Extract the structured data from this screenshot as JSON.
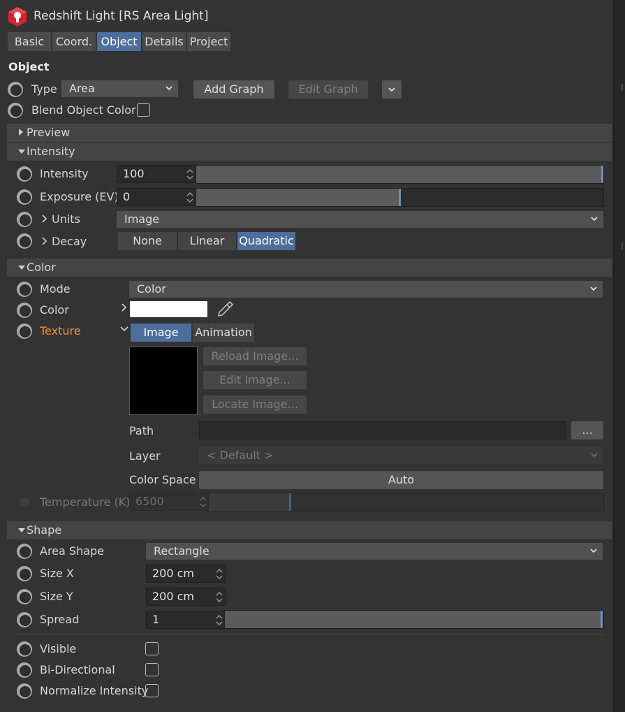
{
  "window": {
    "title": "Redshift Light [RS Area Light]"
  },
  "tabs": [
    {
      "label": "Basic"
    },
    {
      "label": "Coord."
    },
    {
      "label": "Object"
    },
    {
      "label": "Details"
    },
    {
      "label": "Project"
    }
  ],
  "object": {
    "heading": "Object",
    "type_label": "Type",
    "type_value": "Area",
    "add_graph": "Add Graph",
    "edit_graph": "Edit Graph",
    "blend_label": "Blend Object Color"
  },
  "sections": {
    "preview": "Preview",
    "intensity": "Intensity",
    "color": "Color",
    "shape": "Shape"
  },
  "intensity": {
    "intensity_label": "Intensity",
    "intensity_value": "100",
    "intensity_fill": 1.0,
    "exposure_label": "Exposure (EV)",
    "exposure_value": "0",
    "exposure_fill": 0.5,
    "units_label": "Units",
    "units_value": "Image",
    "decay_label": "Decay",
    "decay_options": [
      "None",
      "Linear",
      "Quadratic"
    ],
    "decay_selected": "Quadratic"
  },
  "color": {
    "mode_label": "Mode",
    "mode_value": "Color",
    "color_label": "Color",
    "swatch": "#ffffff",
    "texture_label": "Texture",
    "texture_tabs": [
      "Image",
      "Animation"
    ],
    "reload": "Reload Image...",
    "edit": "Edit Image...",
    "locate": "Locate Image...",
    "path_label": "Path",
    "path_value": "",
    "browse": "...",
    "layer_label": "Layer",
    "layer_value": "< Default >",
    "colorspace_label": "Color Space",
    "colorspace_value": "Auto",
    "temperature_label": "Temperature (K)",
    "temperature_value": "6500"
  },
  "shape": {
    "area_shape_label": "Area Shape",
    "area_shape_value": "Rectangle",
    "sizex_label": "Size X",
    "sizex_value": "200 cm",
    "sizey_label": "Size Y",
    "sizey_value": "200 cm",
    "spread_label": "Spread",
    "spread_value": "1",
    "visible_label": "Visible",
    "bidir_label": "Bi-Directional",
    "normalize_label": "Normalize Intensity"
  },
  "colors": {
    "accent": "#4d6d9a",
    "texture_label": "#f08f3c",
    "brand_icon": "#d2262e"
  }
}
